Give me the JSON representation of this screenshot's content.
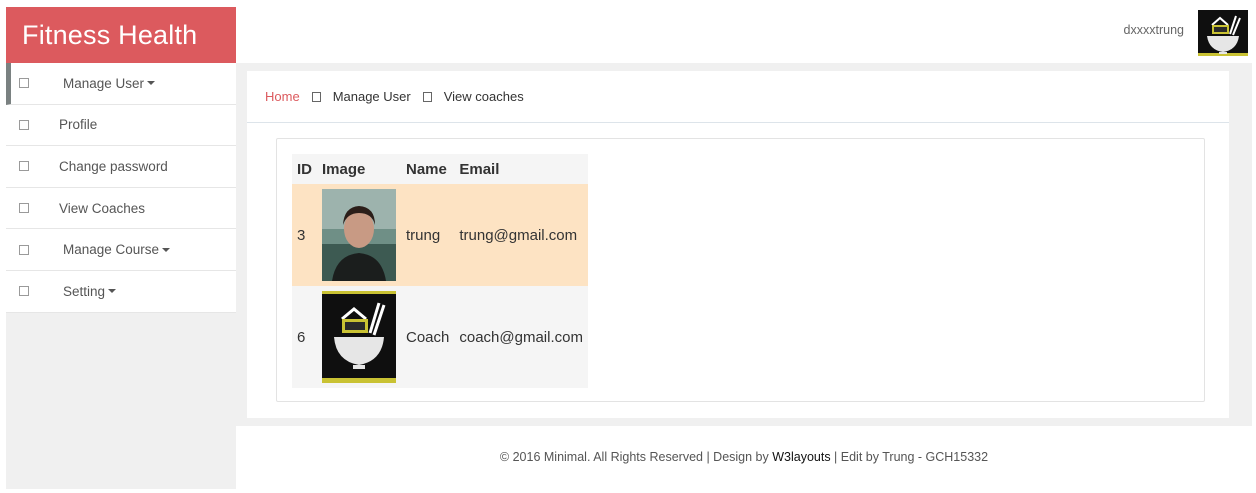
{
  "app": {
    "brand": "Fitness Health"
  },
  "header": {
    "username": "dxxxxtrung"
  },
  "sidebar": {
    "items": [
      {
        "label": "Manage User"
      },
      {
        "label": "Profile"
      },
      {
        "label": "Change password"
      },
      {
        "label": "View Coaches"
      },
      {
        "label": "Manage Course"
      },
      {
        "label": "Setting"
      }
    ]
  },
  "breadcrumb": {
    "home": "Home",
    "level1": "Manage User",
    "level2": "View coaches"
  },
  "table": {
    "columns": [
      "ID",
      "Image",
      "Name",
      "Email"
    ],
    "rows": [
      {
        "id": "3",
        "name": "trung",
        "email": "trung@gmail.com"
      },
      {
        "id": "6",
        "name": "Coach",
        "email": "coach@gmail.com"
      }
    ]
  },
  "footer": {
    "text_before": "© 2016 Minimal. All Rights Reserved | Design by ",
    "link": "W3layouts",
    "text_after": " | Edit by Trung - GCH15332"
  },
  "colors": {
    "brand": "#dc5a5e",
    "row_highlight": "#fde3c3",
    "logo_accent": "#c9c233"
  },
  "icons": {
    "user_avatar": "bowl-logo-icon",
    "coach_photo": "person-photo",
    "menu": "square-glyph-icon"
  }
}
